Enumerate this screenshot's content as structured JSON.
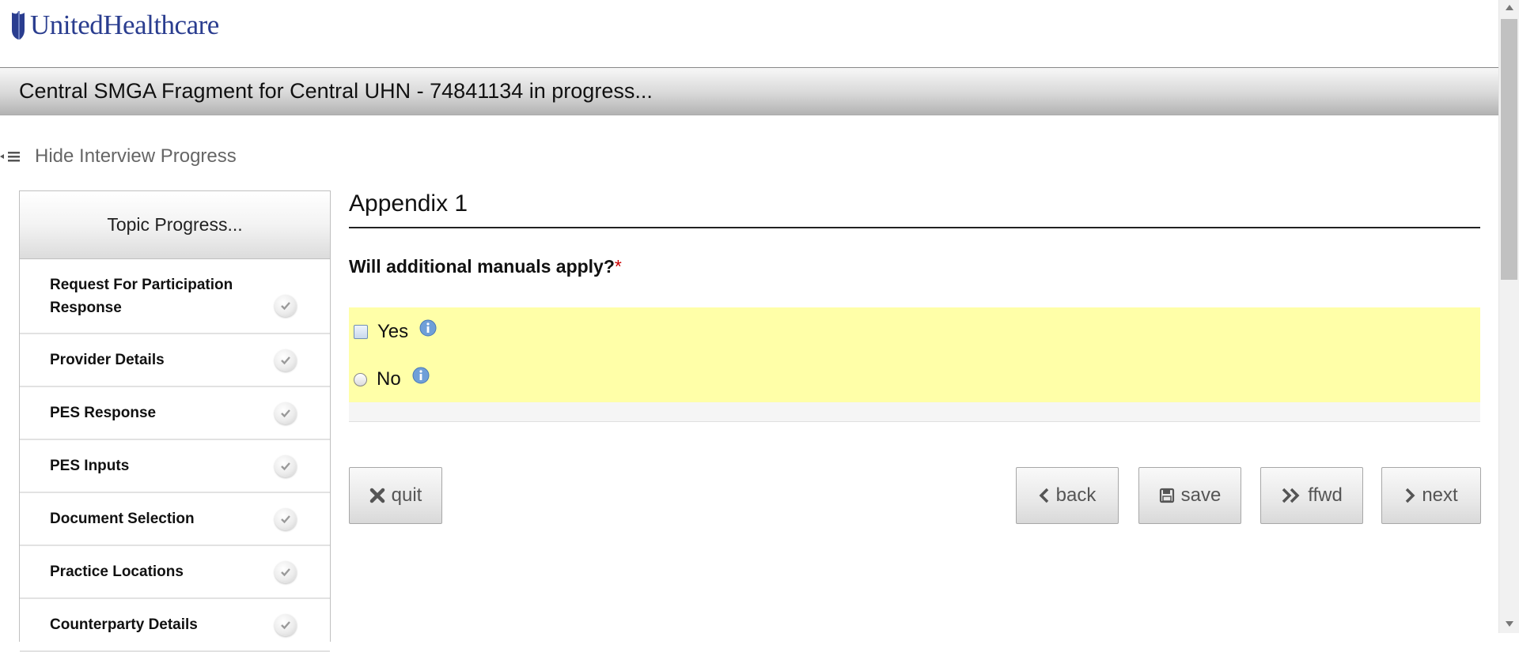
{
  "header": {
    "logo_text": "UnitedHealthcare"
  },
  "title_bar": {
    "title": "Central SMGA Fragment for Central UHN - 74841134 in progress..."
  },
  "progress_toggle": {
    "label": "Hide Interview Progress"
  },
  "sidebar": {
    "header": "Topic Progress...",
    "topics": [
      {
        "label": "Request For Participation Response",
        "status": "complete"
      },
      {
        "label": "Provider Details",
        "status": "complete"
      },
      {
        "label": "PES Response",
        "status": "complete"
      },
      {
        "label": "PES Inputs",
        "status": "complete"
      },
      {
        "label": "Document Selection",
        "status": "complete"
      },
      {
        "label": "Practice Locations",
        "status": "complete"
      },
      {
        "label": "Counterparty Details",
        "status": "complete"
      }
    ]
  },
  "main": {
    "section_title": "Appendix 1",
    "question": "Will additional manuals apply?",
    "required_marker": "*",
    "options": [
      {
        "label": "Yes",
        "control": "checkbox",
        "checked": false
      },
      {
        "label": "No",
        "control": "radio",
        "checked": false
      }
    ]
  },
  "buttons": {
    "quit": "quit",
    "back": "back",
    "save": "save",
    "ffwd": "ffwd",
    "next": "next"
  },
  "colors": {
    "brand": "#2a3d8f",
    "highlight": "#ffffa8",
    "required": "#cc0000"
  }
}
